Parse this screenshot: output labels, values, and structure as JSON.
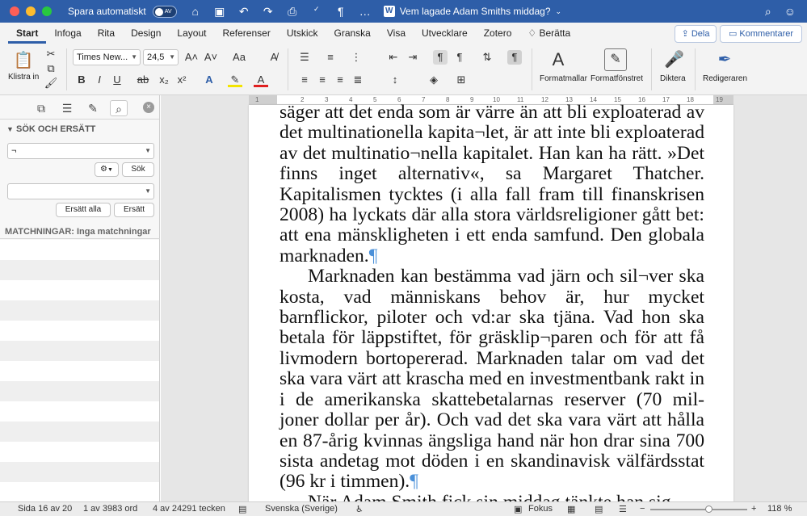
{
  "titlebar": {
    "autosave_label": "Spara automatiskt",
    "autosave_state": "AV",
    "doc_title": "Vem lagade Adam Smiths middag?"
  },
  "tabs": [
    "Start",
    "Infoga",
    "Rita",
    "Design",
    "Layout",
    "Referenser",
    "Utskick",
    "Granska",
    "Visa",
    "Utvecklare",
    "Zotero"
  ],
  "tellme": "Berätta",
  "share_label": "Dela",
  "comments_label": "Kommentarer",
  "ribbon": {
    "paste_label": "Klistra in",
    "font_name": "Times New...",
    "font_size": "24,5",
    "styles_label": "Formatmallar",
    "styles_pane_label": "Formatfönstret",
    "dictate_label": "Diktera",
    "editor_label": "Redigeraren"
  },
  "pane": {
    "heading": "SÖK OCH ERSÄTT",
    "search_value": "¬",
    "replace_value": "",
    "search_button": "Sök",
    "replace_all_button": "Ersätt alla",
    "replace_button": "Ersätt",
    "matches_label": "MATCHNINGAR: Inga matchningar"
  },
  "ruler_ticks": [
    "1",
    "2",
    "3",
    "4",
    "5",
    "6",
    "7",
    "8",
    "9",
    "10",
    "11",
    "12",
    "13",
    "14",
    "15",
    "16",
    "17",
    "18",
    "19"
  ],
  "document": {
    "para1": "säger att det enda som är värre än att bli exploaterad av det multinationella kapita¬let, är att inte bli exploaterad av det multinatio¬nella kapitalet. Han kan ha rätt. »Det finns inget alternativ«, sa Margaret Thatcher. Kapitalismen tycktes (i alla fall fram till finanskrisen 2008) ha lyckats där alla stora världsreligioner gått bet: att ena mänskligheten i ett enda samfund. Den globala marknaden.",
    "para2": "Marknaden kan bestämma vad järn och sil¬ver ska kosta, vad människans behov är, hur mycket barnflickor, piloter och vd:ar ska tjäna. Vad hon ska betala för läppstiftet, för gräsklip¬paren och för att få livmodern bortopererad. Marknaden talar om vad det ska vara värt att krascha med en investmentbank rakt in i de amerikanska skattebetalarnas reserver (70 mil-joner dollar per år). Och vad det ska vara värt att hålla en 87-årig kvinnas ängsliga hand när hon drar sina 700 sista andetag mot döden i en skandinavisk välfärdsstat (96 kr i timmen).",
    "para3": "När Adam Smith fick sin middag tänkte han sig",
    "pilcrow": "¶"
  },
  "status": {
    "page": "Sida 16 av 20",
    "words": "1 av 3983 ord",
    "chars": "4 av 24291 tecken",
    "language": "Svenska (Sverige)",
    "focus": "Fokus",
    "zoom": "118 %",
    "zoom_level": 0.6
  }
}
